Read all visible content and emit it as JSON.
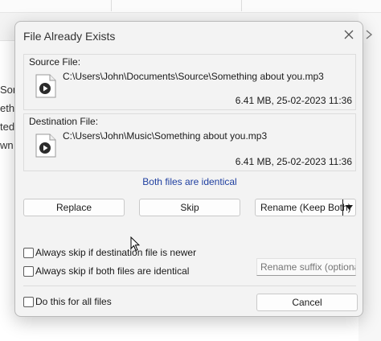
{
  "background": {
    "fragments": [
      "Son",
      "ethi",
      "ted",
      "wn o"
    ]
  },
  "dialog": {
    "title": "File Already Exists",
    "close_icon": "close-icon",
    "source": {
      "label": "Source File:",
      "path": "C:\\Users\\John\\Documents\\Source\\Something about you.mp3",
      "meta": "6.41 MB, 25-02-2023 11:36",
      "icon": "media-file-icon"
    },
    "destination": {
      "label": "Destination File:",
      "path": "C:\\Users\\John\\Music\\Something about you.mp3",
      "meta": "6.41 MB, 25-02-2023 11:36",
      "icon": "media-file-icon"
    },
    "status": "Both files are identical",
    "buttons": {
      "replace": "Replace",
      "skip": "Skip",
      "rename": "Rename (Keep Both)",
      "cancel": "Cancel"
    },
    "options": {
      "skip_newer": "Always skip if destination file is newer",
      "skip_identical": "Always skip if both files are identical",
      "all_files": "Do this for all files"
    },
    "suffix_placeholder": "Rename suffix (optional)"
  },
  "colors": {
    "status_text": "#1f3fa0",
    "dialog_bg": "#f3f3f3",
    "button_bg": "#fdfdfd"
  }
}
